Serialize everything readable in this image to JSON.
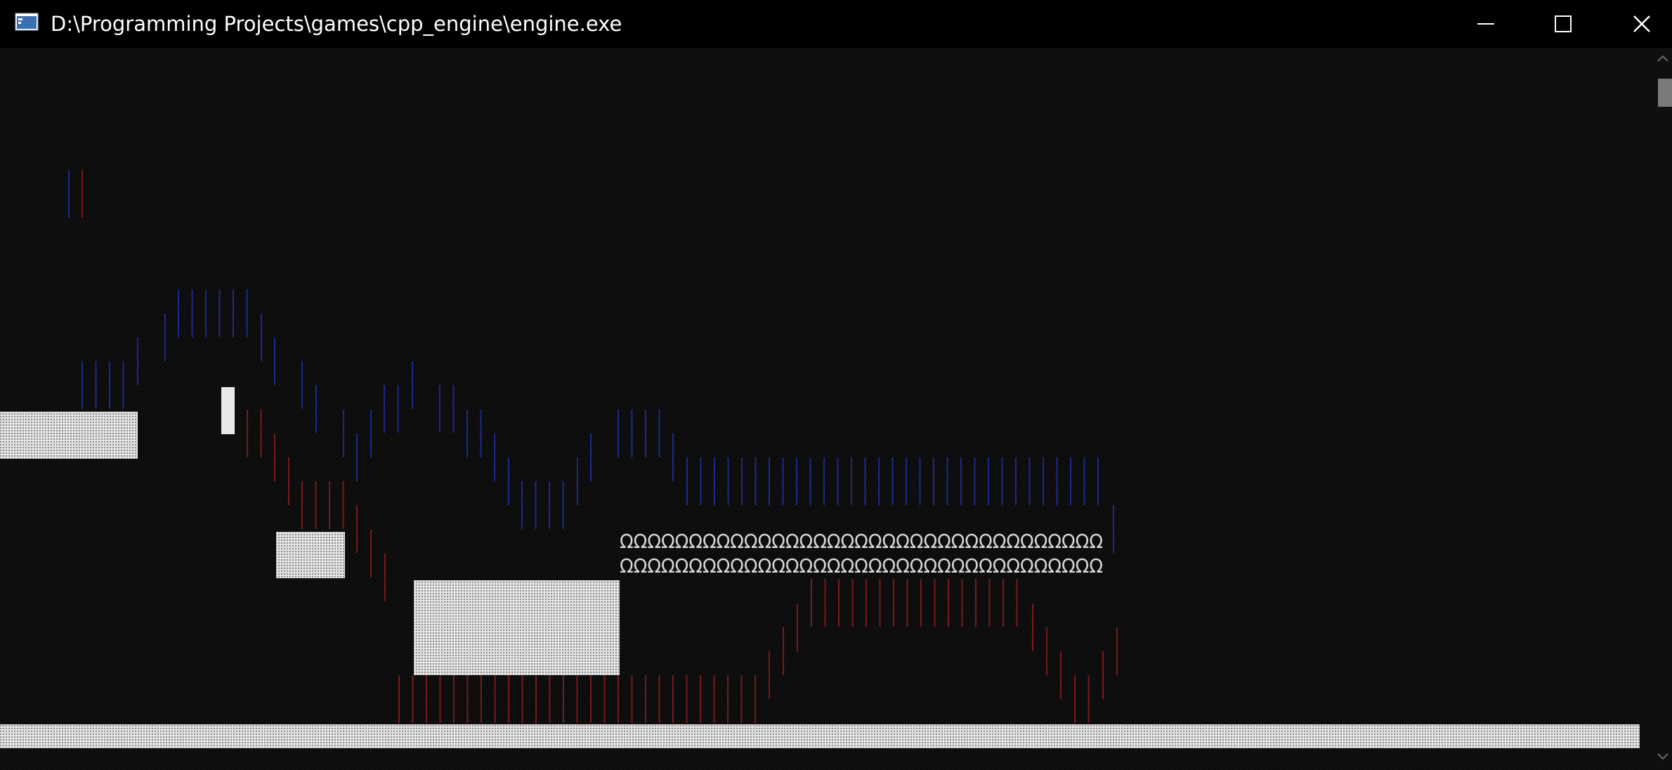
{
  "window": {
    "title": "D:\\Programming Projects\\games\\cpp_engine\\engine.exe",
    "icon": "console-app-icon",
    "controls": [
      "minimize-icon",
      "maximize-icon",
      "close-icon"
    ]
  },
  "console": {
    "background": "#0c0c0c",
    "block_color": "#d4d4d4",
    "blue_trail_color": "#1c2a8c",
    "red_trail_color": "#7a1a1a",
    "player_color": "#e8e8e8",
    "omega_row_1": "ΩΩΩΩΩΩΩΩΩΩΩΩΩΩΩΩΩΩΩΩΩΩΩΩΩΩΩΩΩΩΩΩΩΩΩ",
    "omega_row_2": "ΩΩΩΩΩΩΩΩΩΩΩΩΩΩΩΩΩΩΩΩΩΩΩΩΩΩΩΩΩΩΩΩΩΩΩ"
  },
  "scrollbar": {
    "up_icon": "chevron-up-icon",
    "down_icon": "chevron-down-icon"
  }
}
